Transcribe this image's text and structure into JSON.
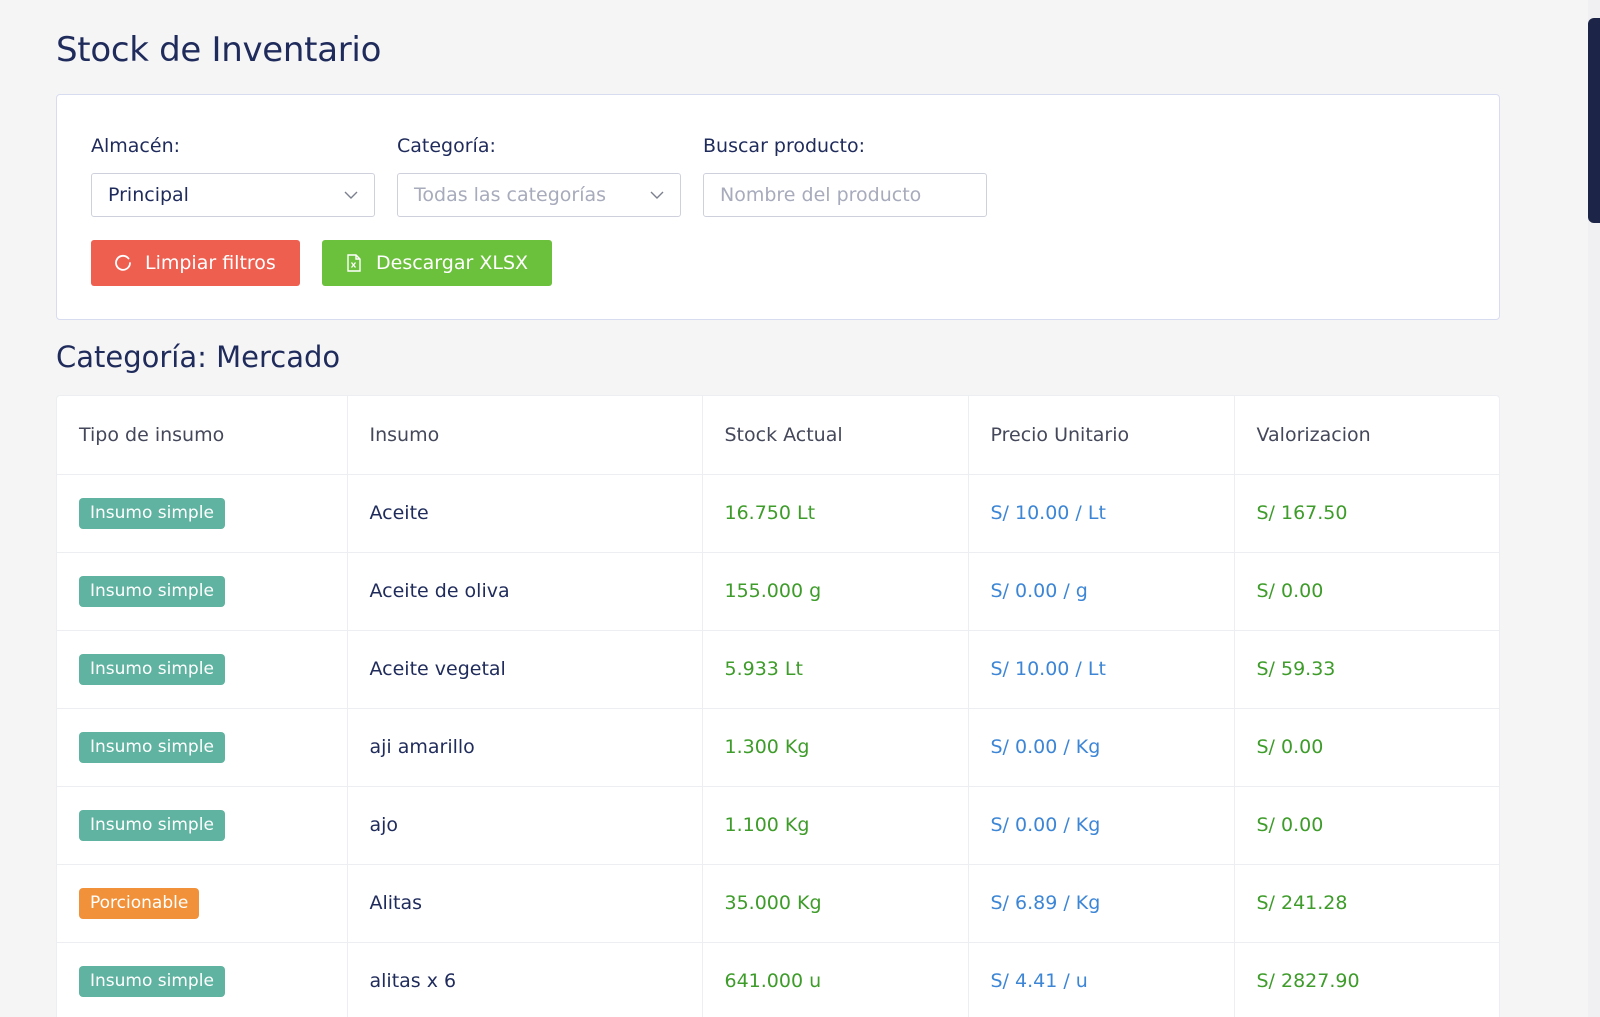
{
  "page": {
    "title": "Stock de Inventario"
  },
  "filters": {
    "almacen": {
      "label": "Almacén:",
      "value": "Principal"
    },
    "categoria": {
      "label": "Categoría:",
      "placeholder": "Todas las categorías"
    },
    "buscar": {
      "label": "Buscar producto:",
      "placeholder": "Nombre del producto"
    },
    "clear_label": "Limpiar filtros",
    "download_label": "Descargar XLSX"
  },
  "section": {
    "title": "Categoría: Mercado"
  },
  "table": {
    "headers": [
      "Tipo de insumo",
      "Insumo",
      "Stock Actual",
      "Precio Unitario",
      "Valorizacion"
    ],
    "rows": [
      {
        "tipo": "Insumo simple",
        "kind": "simple",
        "insumo": "Aceite",
        "stock": "16.750 Lt",
        "precio": "S/ 10.00 / Lt",
        "valor": "S/ 167.50"
      },
      {
        "tipo": "Insumo simple",
        "kind": "simple",
        "insumo": "Aceite de oliva",
        "stock": "155.000 g",
        "precio": "S/ 0.00 / g",
        "valor": "S/ 0.00"
      },
      {
        "tipo": "Insumo simple",
        "kind": "simple",
        "insumo": "Aceite vegetal",
        "stock": "5.933 Lt",
        "precio": "S/ 10.00 / Lt",
        "valor": "S/ 59.33"
      },
      {
        "tipo": "Insumo simple",
        "kind": "simple",
        "insumo": "aji amarillo",
        "stock": "1.300 Kg",
        "precio": "S/ 0.00 / Kg",
        "valor": "S/ 0.00"
      },
      {
        "tipo": "Insumo simple",
        "kind": "simple",
        "insumo": "ajo",
        "stock": "1.100 Kg",
        "precio": "S/ 0.00 / Kg",
        "valor": "S/ 0.00"
      },
      {
        "tipo": "Porcionable",
        "kind": "porc",
        "insumo": "Alitas",
        "stock": "35.000 Kg",
        "precio": "S/ 6.89 / Kg",
        "valor": "S/ 241.28"
      },
      {
        "tipo": "Insumo simple",
        "kind": "simple",
        "insumo": "alitas x 6",
        "stock": "641.000 u",
        "precio": "S/ 4.41 / u",
        "valor": "S/ 2827.90"
      }
    ]
  },
  "colors": {
    "title": "#1f2b5b",
    "clear_button": "#ee5f50",
    "download_button": "#6cc13c",
    "badge_simple": "#5fb3a0",
    "badge_porcionable": "#f1923a",
    "stock_text": "#3e9c2a",
    "price_text": "#3d86d6"
  },
  "icons": {
    "select_caret": "chevron-down-icon",
    "clear_button": "refresh-icon",
    "download_button": "excel-file-icon"
  }
}
